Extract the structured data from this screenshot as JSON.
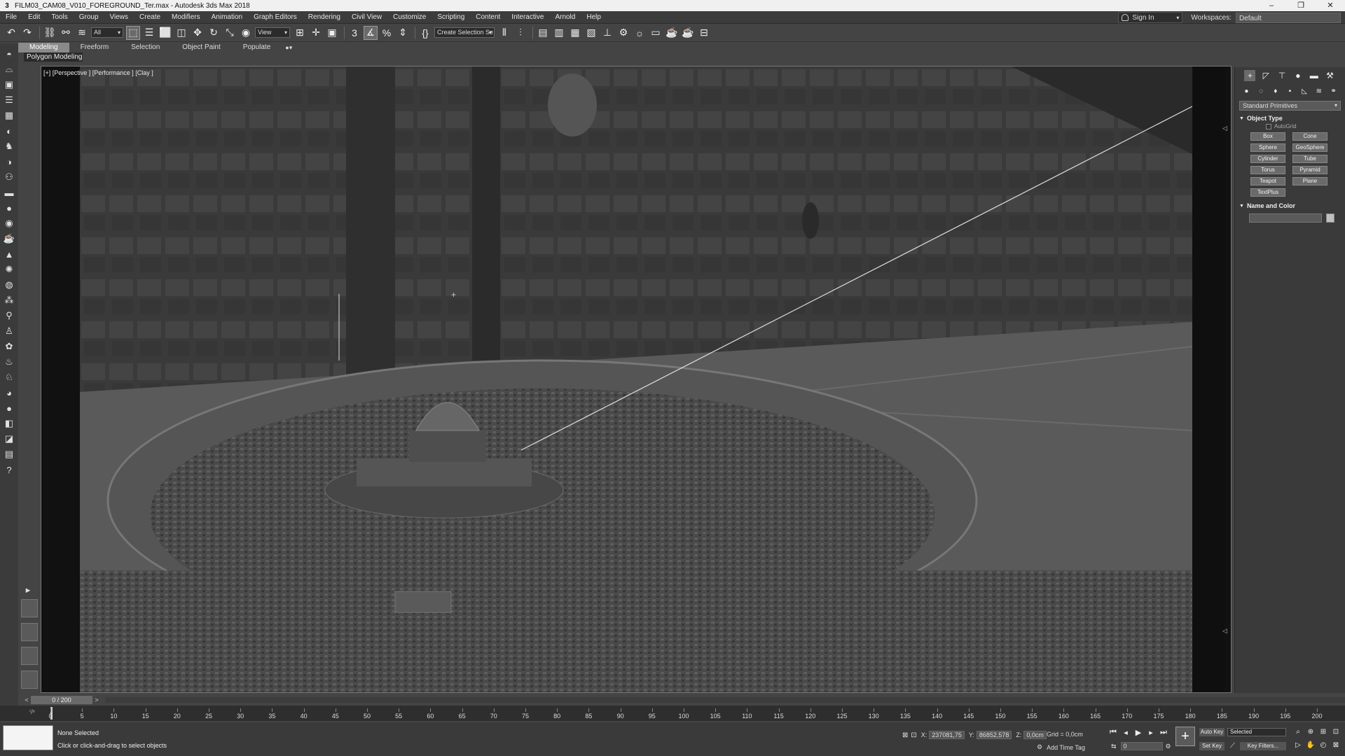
{
  "window": {
    "app_icon": "3",
    "title": "FILM03_CAM08_V010_FOREGROUND_Ter.max - Autodesk 3ds Max 2018",
    "controls": [
      "–",
      "❐",
      "✕"
    ]
  },
  "menu": {
    "items": [
      "File",
      "Edit",
      "Tools",
      "Group",
      "Views",
      "Create",
      "Modifiers",
      "Animation",
      "Graph Editors",
      "Rendering",
      "Civil View",
      "Customize",
      "Scripting",
      "Content",
      "Interactive",
      "Arnold",
      "Help"
    ],
    "sign_in": "Sign In",
    "workspaces_label": "Workspaces:",
    "workspaces_value": "Default"
  },
  "toolbar": {
    "filter_value": "All",
    "refcoord_value": "View",
    "selection_set_value": "Create Selection Se"
  },
  "ribbon": {
    "tabs": [
      "Modeling",
      "Freeform",
      "Selection",
      "Object Paint",
      "Populate"
    ],
    "active_tab": "Modeling",
    "toggle": "●▾",
    "panel_label": "Polygon Modeling"
  },
  "viewport": {
    "label": "[+] [Perspective ] [Performance ] [Clay ]",
    "arrow_top": "◁",
    "arrow_bottom": "◁"
  },
  "command_panel": {
    "dropdown_value": "Standard Primitives",
    "object_type_title": "Object Type",
    "autogrid_label": "AutoGrid",
    "primitives": [
      "Box",
      "Cone",
      "Sphere",
      "GeoSphere",
      "Cylinder",
      "Tube",
      "Torus",
      "Pyramid",
      "Teapot",
      "Plane",
      "TextPlus"
    ],
    "name_color_title": "Name and Color"
  },
  "timeline": {
    "frame_display": "0 / 200",
    "prev": "<",
    "next": ">",
    "ticks": [
      "0",
      "5",
      "10",
      "15",
      "20",
      "25",
      "30",
      "35",
      "40",
      "45",
      "50",
      "55",
      "60",
      "65",
      "70",
      "75",
      "80",
      "85",
      "90",
      "95",
      "100",
      "105",
      "110",
      "115",
      "120",
      "125",
      "130",
      "135",
      "140",
      "145",
      "150",
      "155",
      "160",
      "165",
      "170",
      "175",
      "180",
      "185",
      "190",
      "195",
      "200"
    ],
    "trackbar_icon": "⁽/ᵛ"
  },
  "status": {
    "line1": "None Selected",
    "line2": "Click or click-and-drag to select objects",
    "x_label": "X:",
    "x_value": "237081,75",
    "y_label": "Y:",
    "y_value": "86852,578",
    "z_label": "Z:",
    "z_value": "0,0cm",
    "grid": "Grid = 0,0cm",
    "add_time_tag": "Add Time Tag",
    "current_frame": "0",
    "auto_key": "Auto Key",
    "set_key": "Set Key",
    "selected": "Selected",
    "key_filters": "Key Filters..."
  },
  "icons": {
    "key_button": "+"
  }
}
